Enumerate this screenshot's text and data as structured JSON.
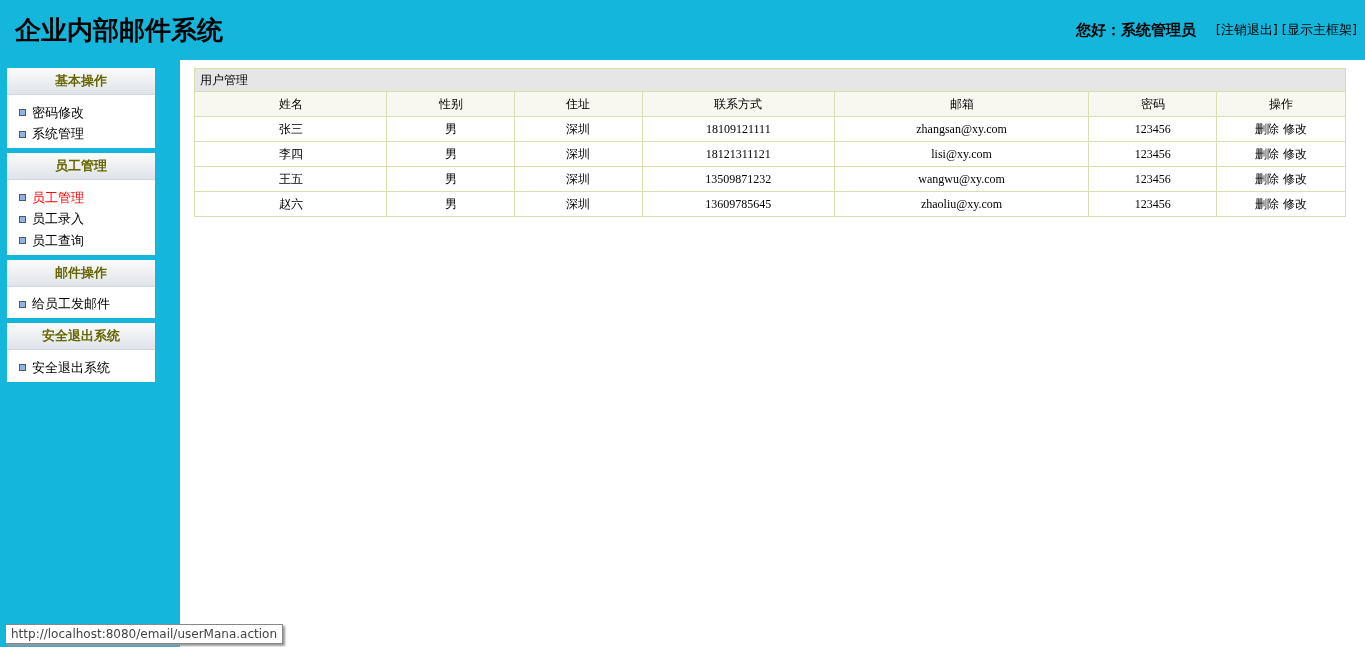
{
  "header": {
    "title": "企业内部邮件系统",
    "greeting": "您好：系统管理员",
    "links": [
      "[注销退出]",
      "[显示主框架]"
    ]
  },
  "sidebar": {
    "groups": [
      {
        "title": "基本操作",
        "items": [
          {
            "label": "密码修改",
            "selected": false
          },
          {
            "label": "系统管理",
            "selected": false
          }
        ]
      },
      {
        "title": "员工管理",
        "items": [
          {
            "label": "员工管理",
            "selected": true
          },
          {
            "label": "员工录入",
            "selected": false
          },
          {
            "label": "员工查询",
            "selected": false
          }
        ]
      },
      {
        "title": "邮件操作",
        "items": [
          {
            "label": "给员工发邮件",
            "selected": false
          }
        ]
      },
      {
        "title": "安全退出系统",
        "items": [
          {
            "label": "安全退出系统",
            "selected": false
          }
        ]
      }
    ]
  },
  "table": {
    "title": "用户管理",
    "columns": [
      "姓名",
      "性别",
      "住址",
      "联系方式",
      "邮箱",
      "密码",
      "操作"
    ],
    "rows": [
      {
        "cells": [
          "张三",
          "男",
          "深圳",
          "18109121111",
          "zhangsan@xy.com",
          "123456"
        ],
        "actions": [
          "删除",
          "修改"
        ]
      },
      {
        "cells": [
          "李四",
          "男",
          "深圳",
          "18121311121",
          "lisi@xy.com",
          "123456"
        ],
        "actions": [
          "删除",
          "修改"
        ]
      },
      {
        "cells": [
          "王五",
          "男",
          "深圳",
          "13509871232",
          "wangwu@xy.com",
          "123456"
        ],
        "actions": [
          "删除",
          "修改"
        ]
      },
      {
        "cells": [
          "赵六",
          "男",
          "深圳",
          "13609785645",
          "zhaoliu@xy.com",
          "123456"
        ],
        "actions": [
          "删除",
          "修改"
        ]
      }
    ]
  },
  "status_bar": {
    "url": "http://localhost:8080/email/userMana.action"
  }
}
